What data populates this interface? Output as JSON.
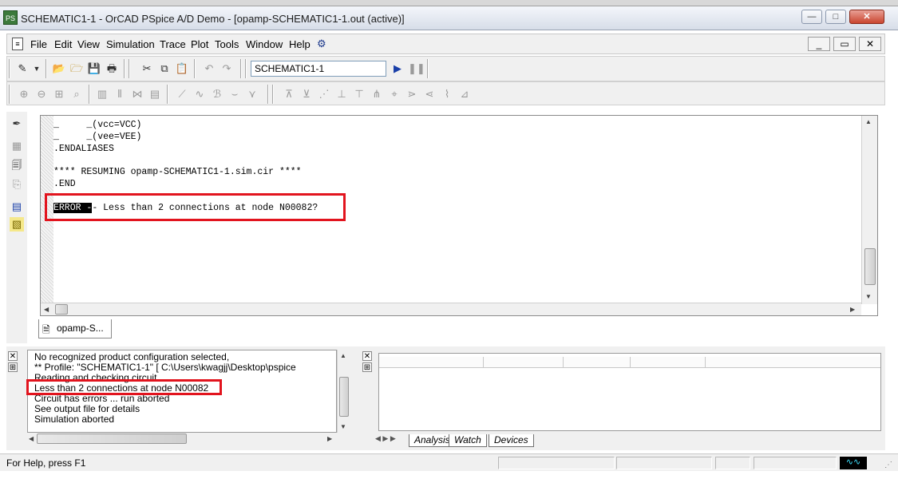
{
  "window": {
    "title": "SCHEMATIC1-1 - OrCAD PSpice A/D Demo - [opamp-SCHEMATIC1-1.out (active)]",
    "controls": {
      "minimize": "—",
      "maximize": "□",
      "close": "✕"
    }
  },
  "menu": {
    "items": [
      "File",
      "Edit",
      "View",
      "Simulation",
      "Trace",
      "Plot",
      "Tools",
      "Window",
      "Help"
    ],
    "mdi_controls": {
      "minimize": "_",
      "restore": "▭",
      "close": "✕"
    }
  },
  "toolbar": {
    "simulation_profile": "SCHEMATIC1-1",
    "icons": [
      "new-icon",
      "open-icon",
      "save-icon",
      "print-icon",
      "cut-icon",
      "copy-icon",
      "paste-icon",
      "undo-icon",
      "redo-icon",
      "run-icon",
      "pause-icon"
    ]
  },
  "output_file": {
    "lines": [
      "_     _(vcc=VCC)",
      "_     _(vee=VEE)",
      ".ENDALIASES",
      "",
      "**** RESUMING opamp-SCHEMATIC1-1.sim.cir ****",
      ".END"
    ],
    "error_prefix": "ERROR -",
    "error_message": "- Less than 2 connections at node N00082?"
  },
  "doc_tab": {
    "label": "opamp-S..."
  },
  "simulation_log": {
    "lines": [
      "No recognized product configuration selected,",
      "** Profile: \"SCHEMATIC1-1\"  [ C:\\Users\\kwagjj\\Desktop\\pspice",
      "Reading and checking circuit",
      "Less than 2 connections at node N00082",
      "Circuit has errors ... run aborted",
      "See output file for details",
      "Simulation aborted"
    ]
  },
  "probe_tabs": [
    "Analysis",
    "Watch",
    "Devices"
  ],
  "status": {
    "help_text": "For Help, press F1"
  },
  "colors": {
    "highlight_box": "#e2141e",
    "title_bar": "#dfe4ec"
  }
}
